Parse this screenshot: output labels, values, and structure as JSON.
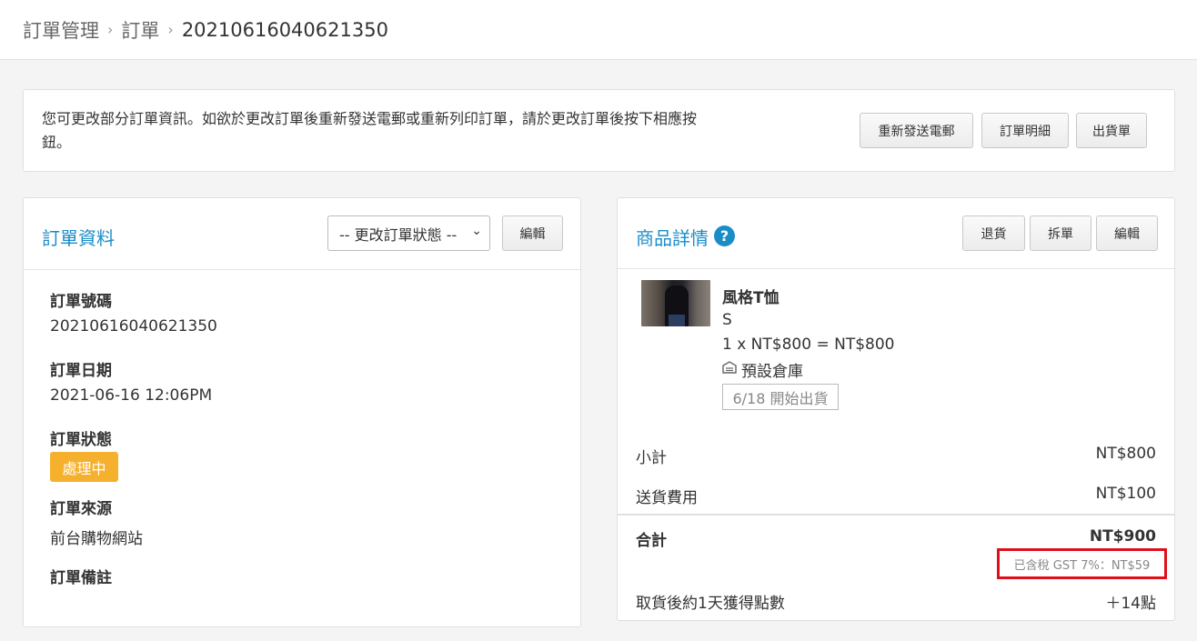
{
  "breadcrumb": {
    "items": [
      "訂單管理",
      "訂單"
    ],
    "current": "20210616040621350",
    "separator": "›"
  },
  "notice": {
    "text": "您可更改部分訂單資訊。如欲於更改訂單後重新發送電郵或重新列印訂單，請於更改訂單後按下相應按鈕。",
    "buttons": {
      "resend_email": "重新發送電郵",
      "order_details": "訂單明細",
      "delivery_note": "出貨單"
    }
  },
  "order_info": {
    "title": "訂單資料",
    "status_select": "-- 更改訂單狀態 --",
    "edit_label": "編輯",
    "order_number_label": "訂單號碼",
    "order_number": "20210616040621350",
    "order_date_label": "訂單日期",
    "order_date": "2021-06-16 12:06PM",
    "order_status_label": "訂單狀態",
    "order_status": "處理中",
    "order_source_label": "訂單來源",
    "order_source": "前台購物網站",
    "order_remarks_label": "訂單備註"
  },
  "product_details": {
    "title": "商品詳情",
    "help_glyph": "?",
    "buttons": {
      "return": "退貨",
      "split": "拆單",
      "edit": "編輯"
    },
    "item": {
      "name": "風格T恤",
      "variant": "S",
      "price_line": "1 x NT$800 = NT$800",
      "warehouse": "預設倉庫",
      "shipping_tag": "6/18 開始出貨"
    },
    "subtotal_label": "小計",
    "subtotal": "NT$800",
    "shipping_fee_label": "送貨費用",
    "shipping_fee": "NT$100",
    "total_label": "合計",
    "total": "NT$900",
    "tax_note": "已含稅 GST 7%：NT$59",
    "points_label": "取貨後約1天獲得點數",
    "points": "＋14點"
  },
  "colors": {
    "accent": "#1a8dc7",
    "status_badge": "#f5b02e",
    "highlight_box": "#e0101a"
  },
  "icons": {
    "help": "question-circle-icon",
    "warehouse": "warehouse-icon",
    "select_caret": "chevron-down-icon"
  }
}
